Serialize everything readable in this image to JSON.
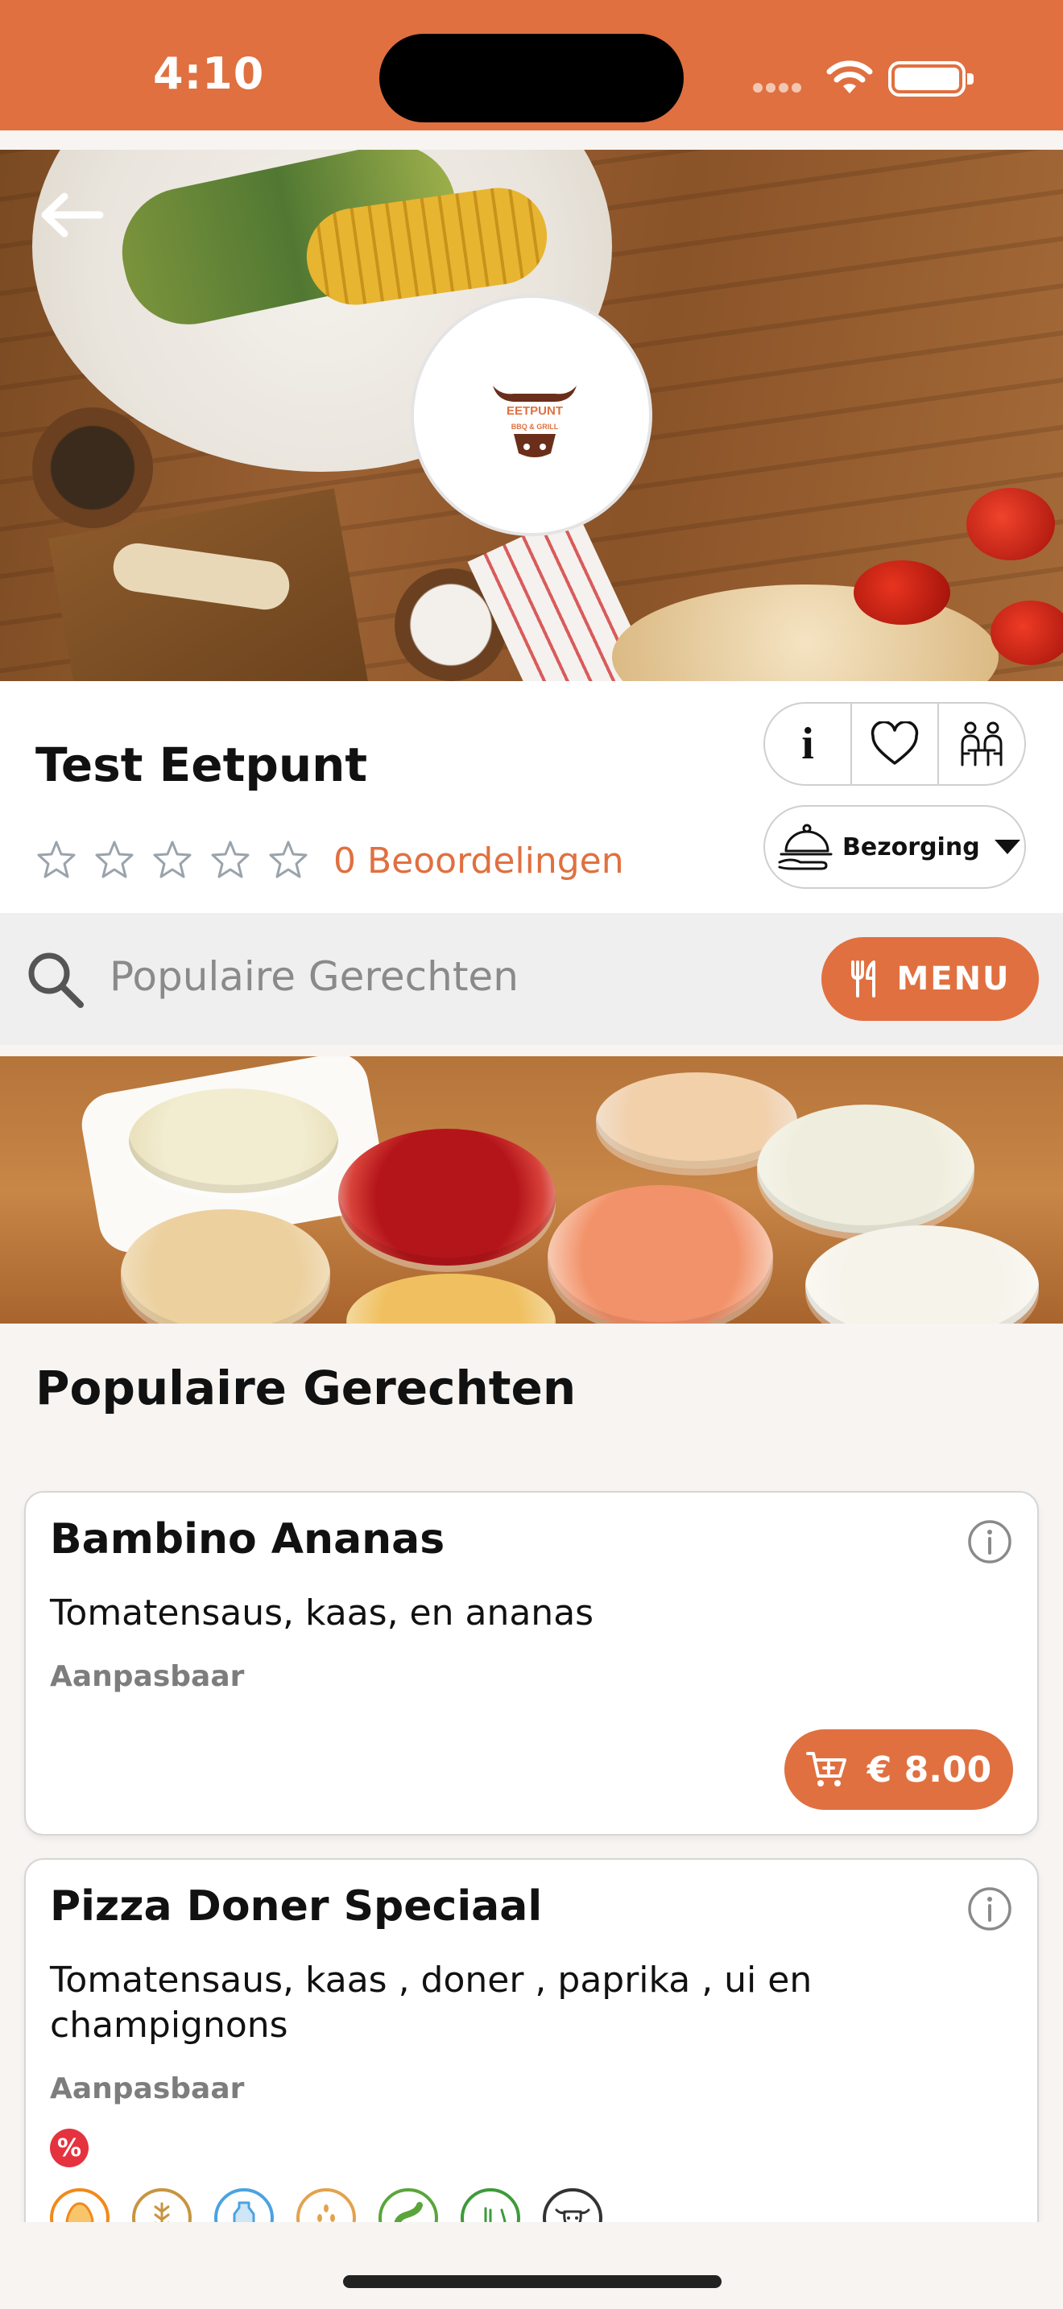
{
  "status_bar": {
    "time": "4:10"
  },
  "colors": {
    "accent": "#e07040"
  },
  "hero": {
    "logo_alt": "EETPUNT BBQ & GRILL logo",
    "logo_text": "EETPUNT",
    "logo_sub": "BBQ & GRILL"
  },
  "restaurant": {
    "name": "Test Eetpunt",
    "rating": 0,
    "max_rating": 5,
    "reviews_label": "0 Beoordelingen"
  },
  "actions": {
    "info_label": "i",
    "delivery_label": "Bezorging"
  },
  "search": {
    "placeholder": "Populaire Gerechten",
    "menu_label": "MENU"
  },
  "section": {
    "title": "Populaire Gerechten"
  },
  "dishes": [
    {
      "name": "Bambino Ananas",
      "description": "Tomatensaus, kaas, en ananas",
      "note": "Aanpasbaar",
      "price": "€ 8.00"
    },
    {
      "name": "Pizza Doner Speciaal",
      "description": "Tomatensaus, kaas , doner , paprika , ui en champignons",
      "note": "Aanpasbaar",
      "discount_icon": "%",
      "allergens": [
        "egg-icon",
        "gluten-icon",
        "milk-icon",
        "sesame-icon",
        "soy-icon",
        "halal-icon",
        "beef-icon"
      ]
    }
  ]
}
